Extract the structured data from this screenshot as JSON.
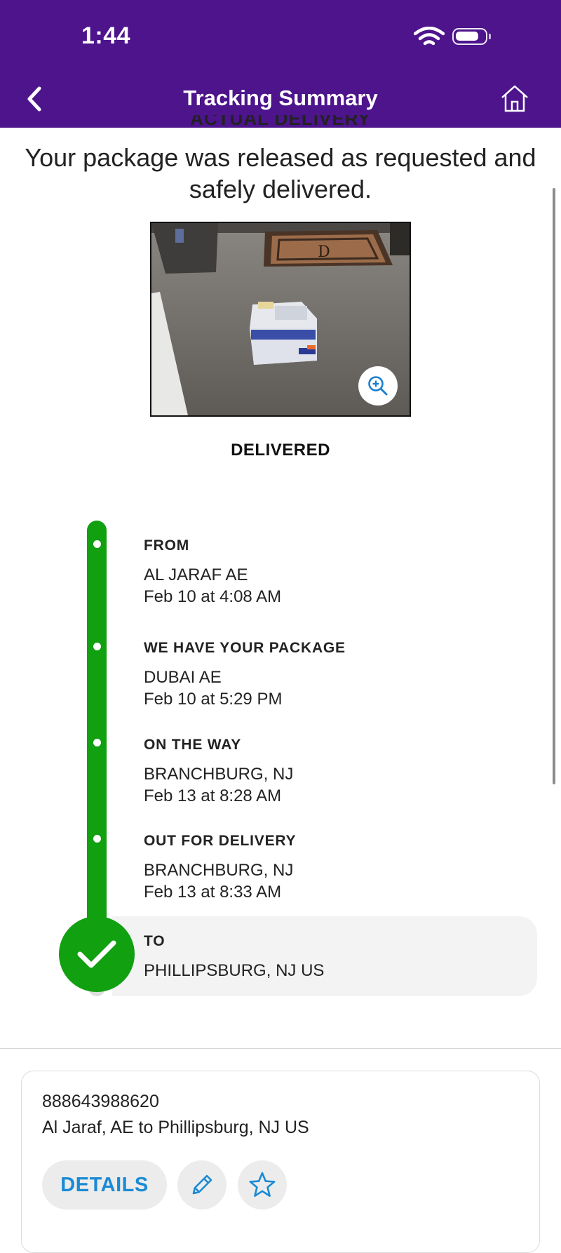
{
  "status_bar": {
    "time": "1:44"
  },
  "header": {
    "title": "Tracking Summary"
  },
  "delivery": {
    "heading": "ACTUAL DELIVERY",
    "message": "Your package was released as requested and safely delivered.",
    "status": "DELIVERED",
    "photo_mat_letter": "D"
  },
  "timeline": [
    {
      "label": "FROM",
      "location": "AL JARAF AE",
      "datetime": "Feb 10 at 4:08 AM"
    },
    {
      "label": "WE HAVE YOUR PACKAGE",
      "location": "DUBAI AE",
      "datetime": "Feb 10 at 5:29 PM"
    },
    {
      "label": "ON THE WAY",
      "location": "BRANCHBURG, NJ",
      "datetime": "Feb 13 at 8:28 AM"
    },
    {
      "label": "OUT FOR DELIVERY",
      "location": "BRANCHBURG, NJ",
      "datetime": "Feb 13 at 8:33 AM"
    },
    {
      "label": "TO",
      "location": "PHILLIPSBURG, NJ  US"
    }
  ],
  "shipment": {
    "tracking_number": "888643988620",
    "route": "Al Jaraf, AE to Phillipsburg, NJ US",
    "details_label": "DETAILS"
  },
  "icons": {
    "back": "chevron-left-icon",
    "home": "home-icon",
    "zoom": "zoom-in-icon",
    "edit": "pencil-icon",
    "favorite": "star-icon",
    "delivered": "checkmark-icon"
  },
  "colors": {
    "brand_purple": "#4d148c",
    "timeline_green": "#10a010",
    "link_blue": "#1a8ad4"
  }
}
